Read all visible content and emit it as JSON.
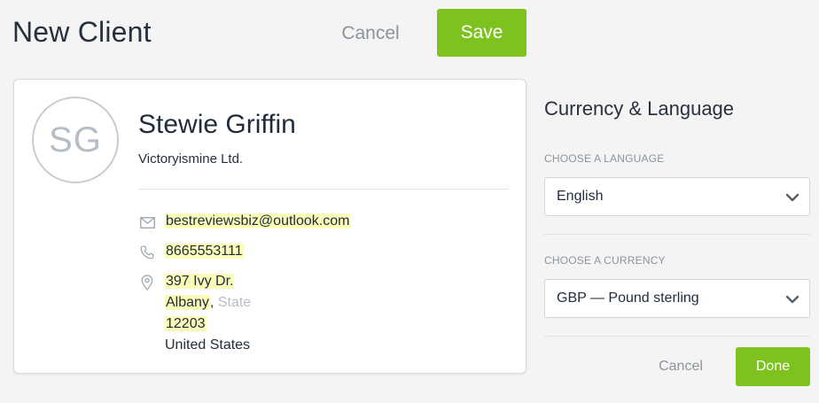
{
  "header": {
    "title": "New Client",
    "cancel_label": "Cancel",
    "save_label": "Save"
  },
  "client": {
    "initials": "SG",
    "name": "Stewie Griffin",
    "company": "Victoryismine Ltd.",
    "email": "bestreviewsbiz@outlook.com",
    "phone": "8665553111",
    "address": {
      "street": "397 Ivy Dr.",
      "city": "Albany",
      "separator": ",",
      "state_placeholder": "State",
      "zip": "12203",
      "country": "United States"
    }
  },
  "side": {
    "title": "Currency & Language",
    "language_label": "CHOOSE A LANGUAGE",
    "language_value": "English",
    "currency_label": "CHOOSE A CURRENCY",
    "currency_value": "GBP — Pound sterling",
    "cancel_label": "Cancel",
    "done_label": "Done"
  },
  "colors": {
    "accent": "#7dc21e",
    "highlight": "#fafcb8",
    "muted": "#8b949c"
  },
  "icons": {
    "email": "envelope-icon",
    "phone": "phone-icon",
    "address": "map-pin-icon",
    "select": "chevron-down-icon"
  }
}
